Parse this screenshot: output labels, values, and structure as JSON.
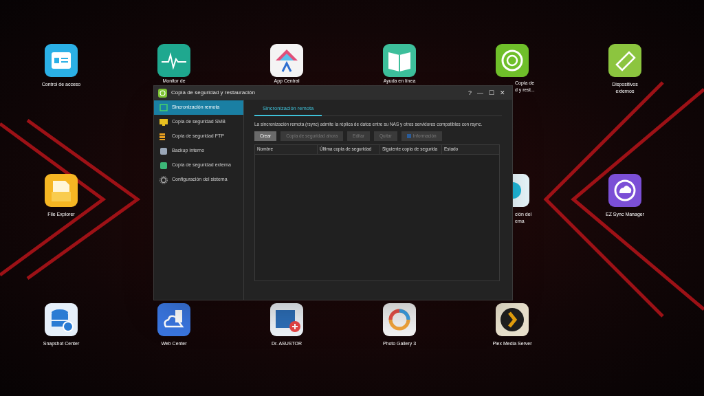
{
  "desktop_icons": [
    {
      "kind": "badge",
      "label": [
        "Control de acceso"
      ]
    },
    {
      "kind": "monitor",
      "label": [
        "Monitor de"
      ]
    },
    {
      "kind": "appcentral",
      "label": [
        "App Central"
      ]
    },
    {
      "kind": "book",
      "label": [
        "Ayuda en línea"
      ]
    },
    {
      "kind": "backup",
      "label": [
        "Copia de",
        "d y rest..."
      ]
    },
    {
      "kind": "usb",
      "label": [
        "Dispositivos",
        "externos"
      ]
    },
    {
      "kind": "folder",
      "label": [
        "File Explorer"
      ]
    },
    {
      "kind": "settings",
      "label": [
        "ción del",
        "ema"
      ]
    },
    {
      "kind": "cloud",
      "label": [
        "EZ Sync Manager"
      ]
    },
    {
      "kind": "database",
      "label": [
        "Snapshot Center"
      ]
    },
    {
      "kind": "web",
      "label": [
        "Web Center"
      ]
    },
    {
      "kind": "doctor",
      "label": [
        "Dr. ASUSTOR"
      ]
    },
    {
      "kind": "photo",
      "label": [
        "Photo Gallery 3"
      ]
    },
    {
      "kind": "plex",
      "label": [
        "Plex Media Server"
      ]
    }
  ],
  "window": {
    "title": "Copia de seguridad y restauración",
    "controls": [
      "?",
      "—",
      "☐",
      "✕"
    ],
    "sidebar": [
      {
        "kind": "sync",
        "label": "Sincronización remota",
        "selected": true
      },
      {
        "kind": "smb",
        "label": "Copia de seguridad SMB",
        "selected": false
      },
      {
        "kind": "ftp",
        "label": "Copia de seguridad FTP",
        "selected": false
      },
      {
        "kind": "internal",
        "label": "Backup Interno",
        "selected": false
      },
      {
        "kind": "external",
        "label": "Copia de seguridad externa",
        "selected": false
      },
      {
        "kind": "gear",
        "label": "Configuración del sistema",
        "selected": false
      }
    ],
    "tabs": [
      {
        "label": "Sincronización remota",
        "selected": true
      }
    ],
    "description": "La sincronización remota (rsync) admite la réplica de datos entre su NAS y otros servidores compatibles con rsync.",
    "buttons": [
      {
        "label": "Crear",
        "disabled": false
      },
      {
        "label": "Copia de seguridad ahora",
        "disabled": true
      },
      {
        "label": "Editar",
        "disabled": true
      },
      {
        "label": "Quitar",
        "disabled": true
      },
      {
        "label": "Información",
        "disabled": true,
        "kind": "info"
      }
    ],
    "table": {
      "columns": [
        "Nombre",
        "Última copia de seguridad",
        "Siguiente copia de segurida",
        "Estado"
      ]
    }
  }
}
